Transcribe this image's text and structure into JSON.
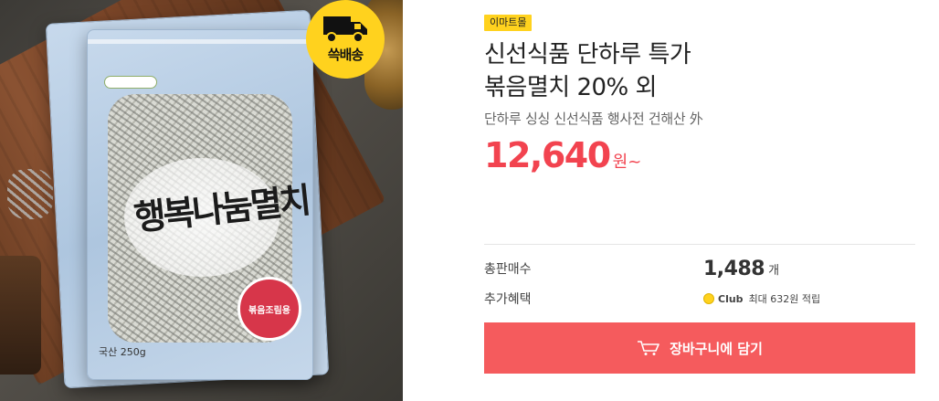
{
  "product_image": {
    "delivery_badge": "쓱배송",
    "truck_icon": "delivery-truck-icon"
  },
  "product": {
    "store_badge": "이마트몰",
    "title_line1": "신선식품 단하루 특가",
    "title_line2": "볶음멸치 20% 외",
    "subtitle": "단하루 싱싱 신선식품 행사전 건해산 外",
    "price": "12,640",
    "price_unit": "원",
    "price_suffix": "~"
  },
  "details": {
    "sales_label": "총판매수",
    "sales_count": "1,488",
    "sales_unit": "개",
    "benefit_label": "추가혜택",
    "club_label": "Club",
    "benefit_text": "최대 632원 적립"
  },
  "actions": {
    "cart_label": "장바구니에 담기",
    "cart_icon": "shopping-cart-icon"
  },
  "colors": {
    "accent_red": "#f55b5d",
    "price_red": "#f2434f",
    "badge_yellow": "#ffd21e"
  }
}
